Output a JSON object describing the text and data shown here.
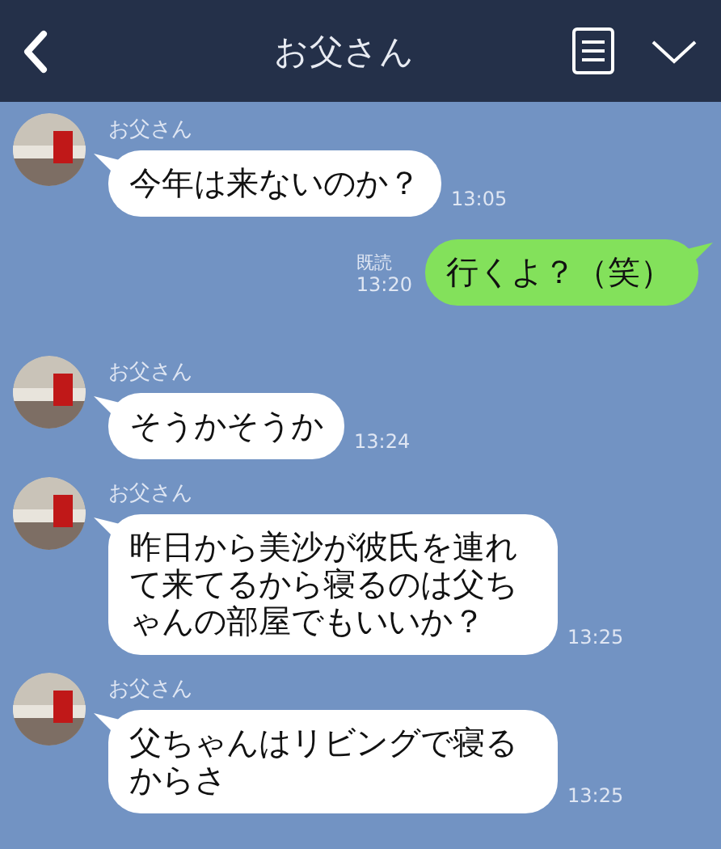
{
  "header": {
    "title": "お父さん"
  },
  "messages": [
    {
      "kind": "incoming",
      "sender": "お父さん",
      "text": "今年は来ないのか？",
      "time": "13:05"
    },
    {
      "kind": "outgoing",
      "text": "行くよ？（笑）",
      "read_label": "既読",
      "time": "13:20"
    },
    {
      "kind": "incoming",
      "sender": "お父さん",
      "text": "そうかそうか",
      "time": "13:24"
    },
    {
      "kind": "incoming",
      "sender": "お父さん",
      "text": "昨日から美沙が彼氏を連れて来てるから寝るのは父ちゃんの部屋でもいいか？",
      "time": "13:25"
    },
    {
      "kind": "incoming",
      "sender": "お父さん",
      "text": "父ちゃんはリビングで寝るからさ",
      "time": "13:25"
    }
  ]
}
